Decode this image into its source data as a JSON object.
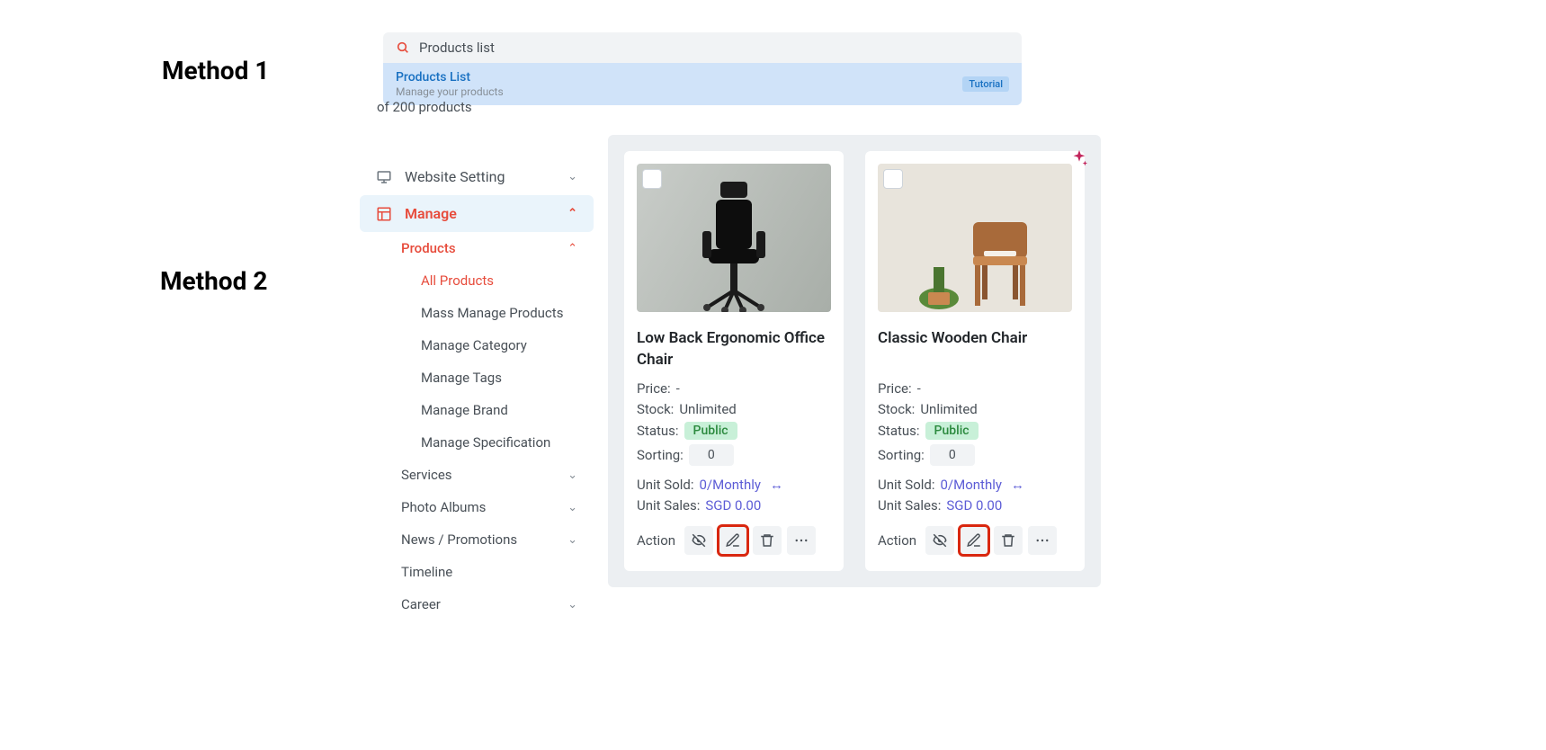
{
  "labels": {
    "method1": "Method 1",
    "method2": "Method 2"
  },
  "search": {
    "query": "Products list",
    "result_title": "Products List",
    "result_sub": "Manage your products",
    "tutorial_badge": "Tutorial"
  },
  "partial_count_text": "of 200 products",
  "sidebar": {
    "website_setting": "Website Setting",
    "manage": "Manage",
    "products": "Products",
    "all_products": "All Products",
    "mass_manage": "Mass Manage Products",
    "manage_category": "Manage Category",
    "manage_tags": "Manage Tags",
    "manage_brand": "Manage Brand",
    "manage_spec": "Manage Specification",
    "services": "Services",
    "photo_albums": "Photo Albums",
    "news_promotions": "News / Promotions",
    "timeline": "Timeline",
    "career": "Career"
  },
  "card_labels": {
    "price": "Price:",
    "stock": "Stock:",
    "status": "Status:",
    "sorting": "Sorting:",
    "unit_sold": "Unit Sold:",
    "unit_sales": "Unit Sales:",
    "action": "Action"
  },
  "products": [
    {
      "title": "Low Back Ergonomic Office Chair",
      "price": "-",
      "stock": "Unlimited",
      "status": "Public",
      "sorting": "0",
      "unit_sold": "0/Monthly",
      "unit_sales": "SGD 0.00",
      "sparkle": false
    },
    {
      "title": "Classic Wooden Chair",
      "price": "-",
      "stock": "Unlimited",
      "status": "Public",
      "sorting": "0",
      "unit_sold": "0/Monthly",
      "unit_sales": "SGD 0.00",
      "sparkle": true
    }
  ]
}
